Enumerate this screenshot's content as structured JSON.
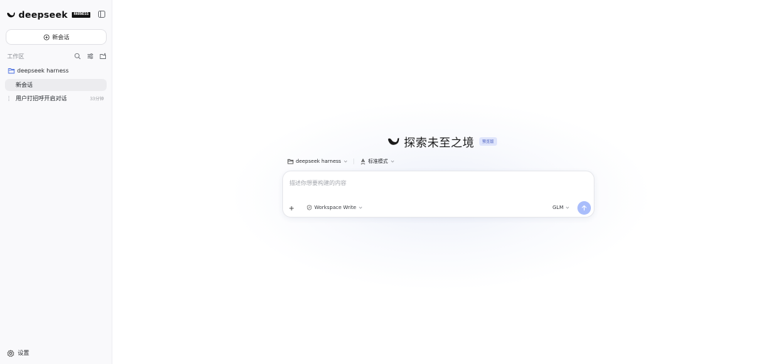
{
  "sidebar": {
    "brand": {
      "name": "deepseek",
      "badge": "HARNESS"
    },
    "new_chat_label": "新会话",
    "workspace_label": "工作区",
    "project_name": "deepseek harness",
    "conversations": [
      {
        "title": "新会话",
        "time": "",
        "active": true
      },
      {
        "title": "用户打招呼开启对话",
        "time": "33分钟",
        "active": false
      }
    ],
    "settings_label": "设置"
  },
  "main": {
    "hero_title": "探索未至之境",
    "preview_badge": "预览版",
    "context": {
      "project": "deepseek harness",
      "mode": "标准模式"
    },
    "composer": {
      "placeholder": "描述你想要构建的内容",
      "permission_mode": "Workspace Write",
      "model": "GLM"
    }
  },
  "colors": {
    "accent": "#a9bdfb",
    "badge_bg": "#dfe5fb",
    "badge_text": "#4a5fc1",
    "sidebar_bg": "#f9f9fb",
    "active_item_bg": "#ececef"
  },
  "icons": [
    "whale-logo-icon",
    "sidebar-toggle-icon",
    "plus-circle-icon",
    "search-icon",
    "filter-icon",
    "new-folder-icon",
    "folder-icon",
    "gear-icon",
    "chevron-down-icon",
    "mode-icon",
    "shield-edit-icon",
    "plus-icon",
    "arrow-up-icon"
  ]
}
